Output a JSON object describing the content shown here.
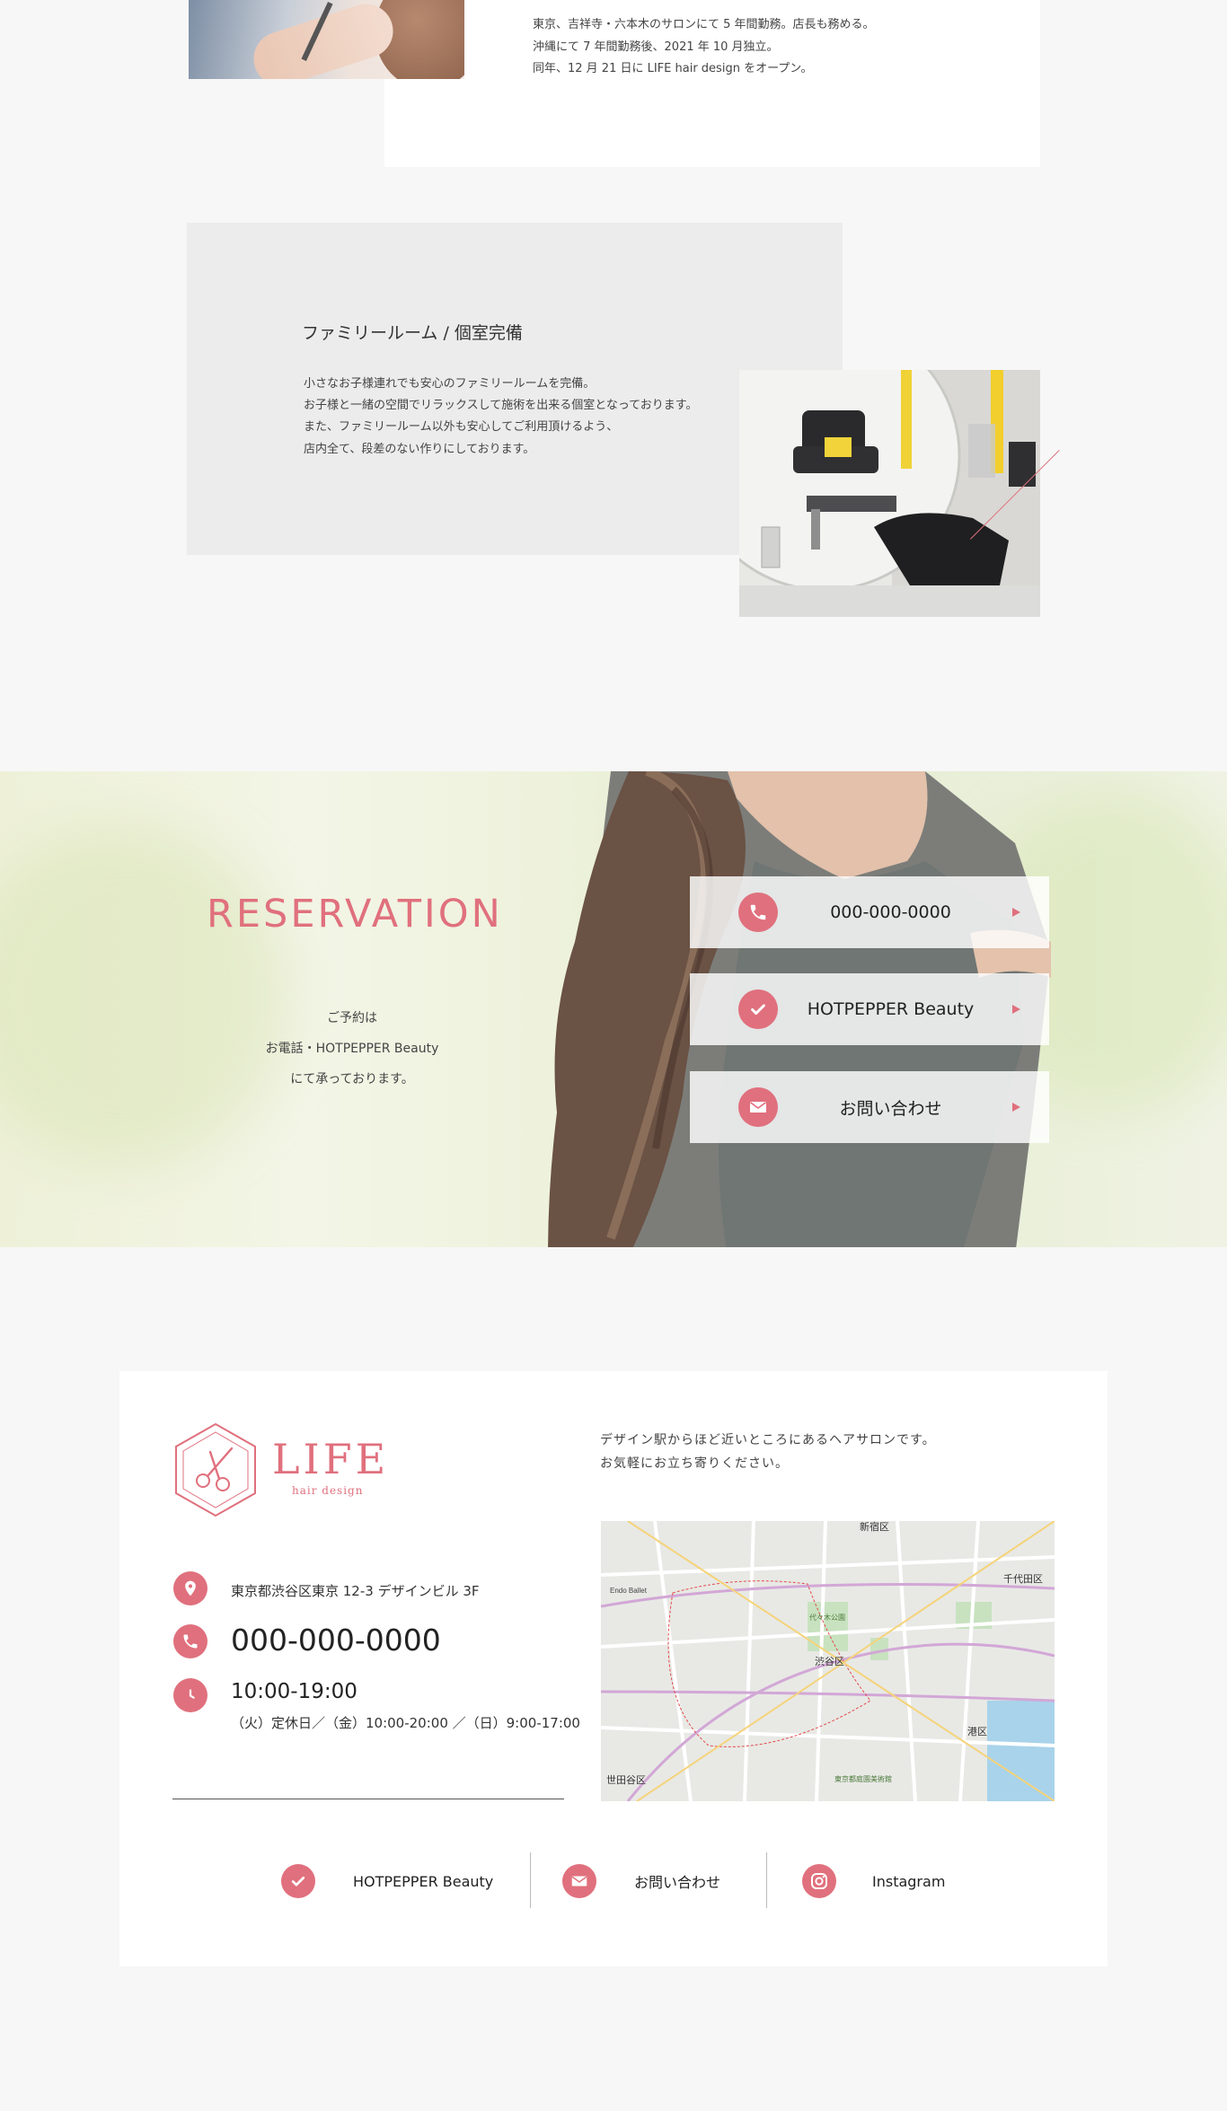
{
  "profile": {
    "lines": [
      "東京、吉祥寺・六本木のサロンにて 5 年間勤務。店長も務める。",
      "沖縄にて 7 年間勤務後、2021 年 10 月独立。",
      "同年、12 月 21 日に LIFE hair design をオープン。"
    ]
  },
  "family": {
    "title": "ファミリールーム / 個室完備",
    "lines": [
      "小さなお子様連れでも安心のファミリールームを完備。",
      "お子様と一緒の空間でリラックスして施術を出来る個室となっております。",
      "また、ファミリールーム以外も安心してご利用頂けるよう、",
      "店内全て、段差のない作りにしております。"
    ]
  },
  "reservation": {
    "title": "RESERVATION",
    "lines": [
      "ご予約は",
      "お電話・HOTPEPPER Beauty",
      "にて承っております。"
    ],
    "buttons": [
      {
        "label": "000-000-0000",
        "icon": "phone-icon"
      },
      {
        "label": "HOTPEPPER Beauty",
        "icon": "check-icon"
      },
      {
        "label": "お問い合わせ",
        "icon": "mail-icon"
      }
    ]
  },
  "footer": {
    "logo": {
      "name": "LIFE",
      "sub": "hair design"
    },
    "description": [
      "デザイン駅からほど近いところにあるヘアサロンです。",
      "お気軽にお立ち寄りください。"
    ],
    "address": "東京都渋谷区東京 12-3 デザインビル 3F",
    "phone": "000-000-0000",
    "hours": "10:00-19:00",
    "hours_note": "（火）定休日／（金）10:00-20:00 ／（日）9:00-17:00",
    "links": [
      {
        "label": "HOTPEPPER Beauty",
        "icon": "check-icon"
      },
      {
        "label": "お問い合わせ",
        "icon": "mail-icon"
      },
      {
        "label": "Instagram",
        "icon": "instagram-icon"
      }
    ],
    "map_labels": [
      "新宿区",
      "千代田区",
      "渋谷区",
      "港区",
      "世田谷区",
      "代々木公園",
      "東京都庭園美術館",
      "Endo Ballet"
    ]
  },
  "colors": {
    "accent": "#e0707d",
    "background": "#f7f7f7"
  }
}
